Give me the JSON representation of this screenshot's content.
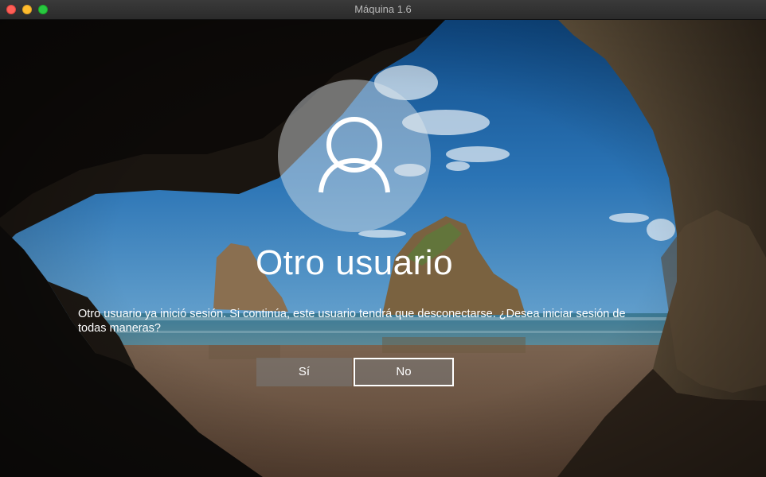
{
  "window": {
    "title": "Máquina 1.6",
    "controls": [
      "close",
      "minimize",
      "maximize"
    ]
  },
  "login": {
    "avatar_icon": "user-silhouette-icon",
    "username": "Otro usuario",
    "message": "Otro usuario ya inició sesión. Si continúa, este usuario tendrá que desconectarse. ¿Desea iniciar sesión de todas maneras?",
    "yes_label": "Sí",
    "no_label": "No"
  },
  "colors": {
    "titlebar": "#2b2b2b",
    "close": "#fe5f57",
    "minimize": "#febc2e",
    "maximize": "#28c840",
    "focus_border": "#ffffff"
  }
}
